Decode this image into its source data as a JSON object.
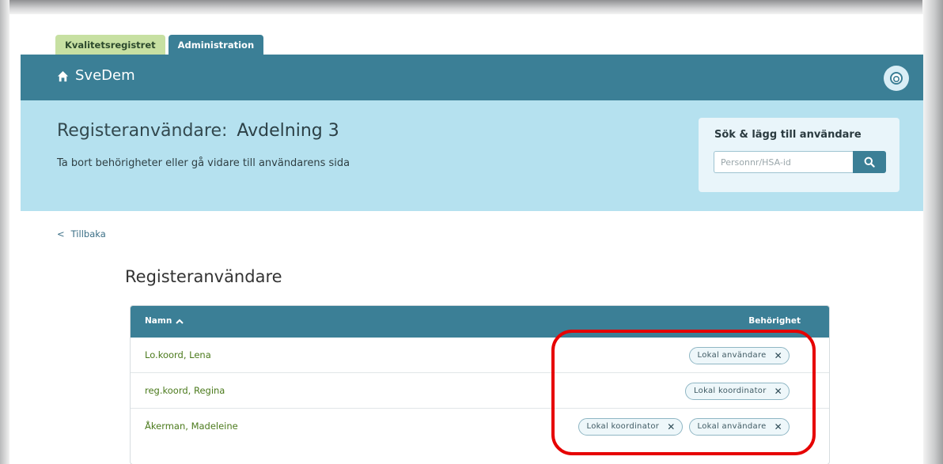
{
  "tabs": {
    "registry": "Kvalitetsregistret",
    "admin": "Administration"
  },
  "topbar": {
    "brand": "SveDem"
  },
  "hero": {
    "title": "Registeranvändare:",
    "department": "Avdelning 3",
    "subtitle": "Ta bort behörigheter eller gå vidare till användarens sida"
  },
  "search": {
    "title": "Sök & lägg till användare",
    "placeholder": "Personnr/HSA-id"
  },
  "back": {
    "arrow": "<",
    "label": "Tillbaka"
  },
  "section": {
    "title": "Registeranvändare"
  },
  "table": {
    "col_name": "Namn",
    "col_perm": "Behörighet",
    "rows": [
      {
        "name": "Lo.koord, Lena",
        "perms": [
          "Lokal användare"
        ]
      },
      {
        "name": "reg.koord, Regina",
        "perms": [
          "Lokal koordinator"
        ]
      },
      {
        "name": "Åkerman, Madeleine",
        "perms": [
          "Lokal koordinator",
          "Lokal användare"
        ]
      }
    ]
  },
  "colors": {
    "primary": "#3b7f96",
    "hero": "#b5e1ef",
    "tab_registry": "#c7e0a2",
    "name_link": "#4b7a1c",
    "highlight": "#e60000"
  },
  "icons": {
    "home": "home-icon",
    "avatar": "avatar-icon",
    "search": "search-icon",
    "sort": "chevron-up-icon",
    "remove": "close-icon"
  }
}
